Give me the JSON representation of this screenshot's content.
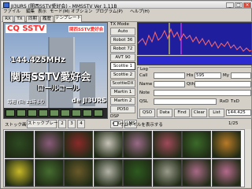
{
  "window": {
    "title": "JI3URS (関西SSTV愛好会) - MMSSTV Ver 1.11B",
    "min": "_",
    "max": "□",
    "close": "×"
  },
  "menu": [
    "ファイル",
    "編集",
    "表示",
    "モード(M)",
    "オプション",
    "プログラム(P)",
    "ヘルプ(H)"
  ],
  "tabs": [
    "RX",
    "TX",
    "同期",
    "履歴",
    "テンプレート"
  ],
  "image": {
    "cq": "CQ SSTV",
    "club_badge": "関西SSTV愛好会",
    "freq": "144.425MHz",
    "club": "関西SSTV愛好会",
    "rollcall": "ロールコール",
    "date_line": "毎週 (日) 21時より",
    "callsign": "de JI3URS"
  },
  "modes": {
    "label": "TX Mode",
    "items": [
      "Auto",
      "Robot 36",
      "Robot 72",
      "AVT 90",
      "Scottie 1",
      "Scottie 2",
      "ScottieDX",
      "Martin 1",
      "Martin 2",
      "PD50"
    ],
    "selected": "Scottie 1"
  },
  "dsp": {
    "label": "DSP",
    "afc": "AFC",
    "lms": "LMS"
  },
  "log": {
    "legend": "Log",
    "call_label": "Call",
    "his_label": "His",
    "his_value": "595",
    "my_label": "My",
    "my_value": "",
    "name_label": "Name",
    "qth_label": "Qth",
    "note_label": "Note",
    "qsl_label": "QSL",
    "rxd": "RxD",
    "txd": "TxD",
    "freq_value": "144.425",
    "buttons": [
      "QSO",
      "Data",
      "Find",
      "Clear",
      "List"
    ]
  },
  "bottom": {
    "stock_label": "ストック画像",
    "stock_tabs": [
      "ストックプレート1",
      "2",
      "3",
      "4"
    ],
    "check_label": "サムネイルを表示する",
    "page": "1/25"
  },
  "thumbnails": [
    {
      "name": "dark-leaves",
      "color": "#2e4a22"
    },
    {
      "name": "pink-flower",
      "color": "#8a5b7a"
    },
    {
      "name": "red-flower",
      "color": "#8a2a2a"
    },
    {
      "name": "white-blossoms",
      "color": "#c8c4b8"
    },
    {
      "name": "pink-bloom",
      "color": "#9a6a88"
    },
    {
      "name": "red-pink-flower",
      "color": "#a04a5a"
    },
    {
      "name": "green-leaves",
      "color": "#3c6a2a"
    },
    {
      "name": "orange-flower",
      "color": "#b87a28"
    },
    {
      "name": "yellow-flower",
      "color": "#c8b828"
    },
    {
      "name": "leaf-bush",
      "color": "#466c30"
    },
    {
      "name": "bird-flower",
      "color": "#6a5a2a"
    },
    {
      "name": "small-blossoms",
      "color": "#b4b4a8"
    },
    {
      "name": "green-foliage",
      "color": "#2e5a20"
    },
    {
      "name": "white-flower",
      "color": "#9a9a8a"
    },
    {
      "name": "pink-flowers",
      "color": "#a86a86"
    },
    {
      "name": "pink-daisy",
      "color": "#b46a8c"
    }
  ]
}
